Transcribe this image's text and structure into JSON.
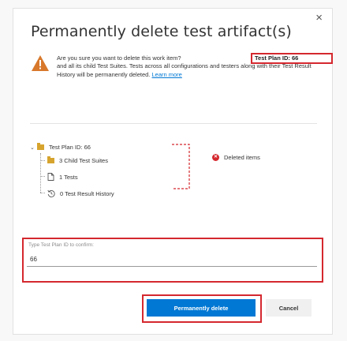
{
  "dialog": {
    "title": "Permanently delete test artifact(s)",
    "close_glyph": "×",
    "warning_text": "Are you sure you want to delete this work item? Test Plan ID: 66 and all its child Test Suites. Tests across all configurations and testers along with their Test Result History will be permanently deleted.",
    "warning_line1": "Are you sure you want to delete this work item?",
    "warning_rest": "and all its child Test Suites. Tests across all configurations and testers along with their Test Result History will be permanently deleted.",
    "highlight": "Test Plan ID: 66",
    "learn_more": "Learn more"
  },
  "tree": {
    "root": "Test Plan ID: 66",
    "children": [
      "3 Child Test Suites",
      "1 Tests",
      "0 Test Result History"
    ]
  },
  "legend": {
    "label": "Deleted items",
    "icon": "x-circle-icon",
    "color": "#d4282e"
  },
  "confirm": {
    "label": "Type Test Plan ID to confirm:",
    "value": "66"
  },
  "buttons": {
    "primary": "Permanently delete",
    "cancel": "Cancel",
    "primary_color": "#0078d4"
  }
}
